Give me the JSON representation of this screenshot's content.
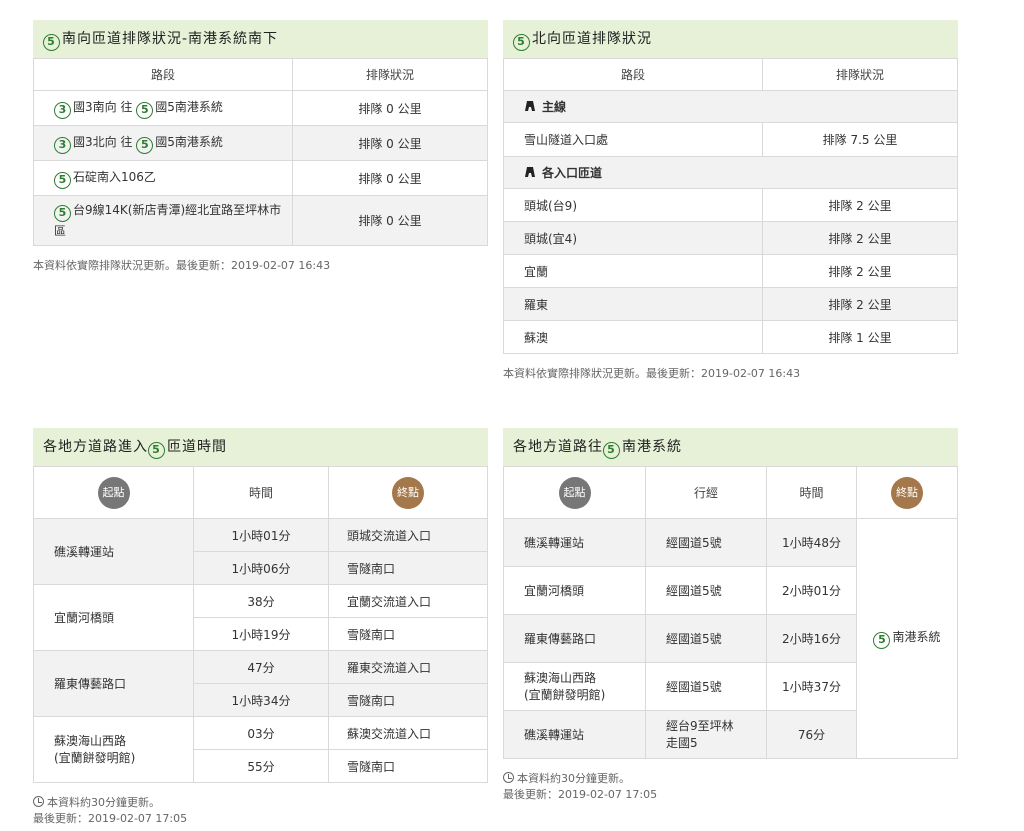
{
  "panel1": {
    "title": "南向匝道排隊狀況-南港系統南下",
    "headers": [
      "路段",
      "排隊狀況"
    ],
    "rows": [
      {
        "prefix_icon": "3",
        "text1": "國3南向 往",
        "mid_icon": "5",
        "text2": "國5南港系統",
        "status": "排隊 0 公里"
      },
      {
        "prefix_icon": "3",
        "text1": "國3北向 往",
        "mid_icon": "5",
        "text2": "國5南港系統",
        "status": "排隊 0 公里"
      },
      {
        "prefix_icon": "5",
        "text1": "石碇南入106乙",
        "status": "排隊 0 公里"
      },
      {
        "prefix_icon": "5",
        "text1": "台9線14K(新店青潭)經北宜路至坪林市區",
        "status": "排隊 0 公里"
      }
    ],
    "note": "本資料依實際排隊狀況更新。最後更新：2019-02-07 16:43"
  },
  "panel2": {
    "title": "北向匝道排隊狀況",
    "headers": [
      "路段",
      "排隊狀況"
    ],
    "group1": "主線",
    "main_rows": [
      {
        "name": "雪山隧道入口處",
        "status": "排隊 7.5 公里"
      }
    ],
    "group2": "各入口匝道",
    "ramp_rows": [
      {
        "name": "頭城(台9)",
        "status": "排隊 2 公里"
      },
      {
        "name": "頭城(宜4)",
        "status": "排隊 2 公里"
      },
      {
        "name": "宜蘭",
        "status": "排隊 2 公里"
      },
      {
        "name": "羅東",
        "status": "排隊 2 公里"
      },
      {
        "name": "蘇澳",
        "status": "排隊 1 公里"
      }
    ],
    "note": "本資料依實際排隊狀況更新。最後更新：2019-02-07 16:43"
  },
  "panel3": {
    "title_before": "各地方道路進入",
    "title_icon": "5",
    "title_after": "匝道時間",
    "headers": {
      "start": "起點",
      "time": "時間",
      "end": "終點"
    },
    "groups": [
      {
        "origin": "礁溪轉運站",
        "rows": [
          {
            "time": "1小時01分",
            "dest": "頭城交流道入口"
          },
          {
            "time": "1小時06分",
            "dest": "雪隧南口"
          }
        ]
      },
      {
        "origin": "宜蘭河橋頭",
        "rows": [
          {
            "time": "38分",
            "dest": "宜蘭交流道入口"
          },
          {
            "time": "1小時19分",
            "dest": "雪隧南口"
          }
        ]
      },
      {
        "origin": "羅東傳藝路口",
        "rows": [
          {
            "time": "47分",
            "dest": "羅東交流道入口"
          },
          {
            "time": "1小時34分",
            "dest": "雪隧南口"
          }
        ]
      },
      {
        "origin": "蘇澳海山西路\n(宜蘭餅發明館)",
        "rows": [
          {
            "time": "03分",
            "dest": "蘇澳交流道入口"
          },
          {
            "time": "55分",
            "dest": "雪隧南口"
          }
        ]
      }
    ],
    "note1": "本資料約30分鐘更新。",
    "note2": "最後更新：2019-02-07 17:05"
  },
  "panel4": {
    "title_before": "各地方道路往",
    "title_icon": "5",
    "title_after": "南港系統",
    "headers": {
      "start": "起點",
      "via": "行經",
      "time": "時間",
      "end": "終點"
    },
    "rows": [
      {
        "origin": "礁溪轉運站",
        "via": "經國道5號",
        "time": "1小時48分"
      },
      {
        "origin": "宜蘭河橋頭",
        "via": "經國道5號",
        "time": "2小時01分"
      },
      {
        "origin": "羅東傳藝路口",
        "via": "經國道5號",
        "time": "2小時16分"
      },
      {
        "origin": "蘇澳海山西路\n(宜蘭餅發明館)",
        "via": "經國道5號",
        "time": "1小時37分"
      },
      {
        "origin": "礁溪轉運站",
        "via": "經台9至坪林\n走國5",
        "time": "76分"
      }
    ],
    "dest_icon": "5",
    "dest": "南港系統",
    "note1": "本資料約30分鐘更新。",
    "note2": "最後更新：2019-02-07 17:05"
  }
}
